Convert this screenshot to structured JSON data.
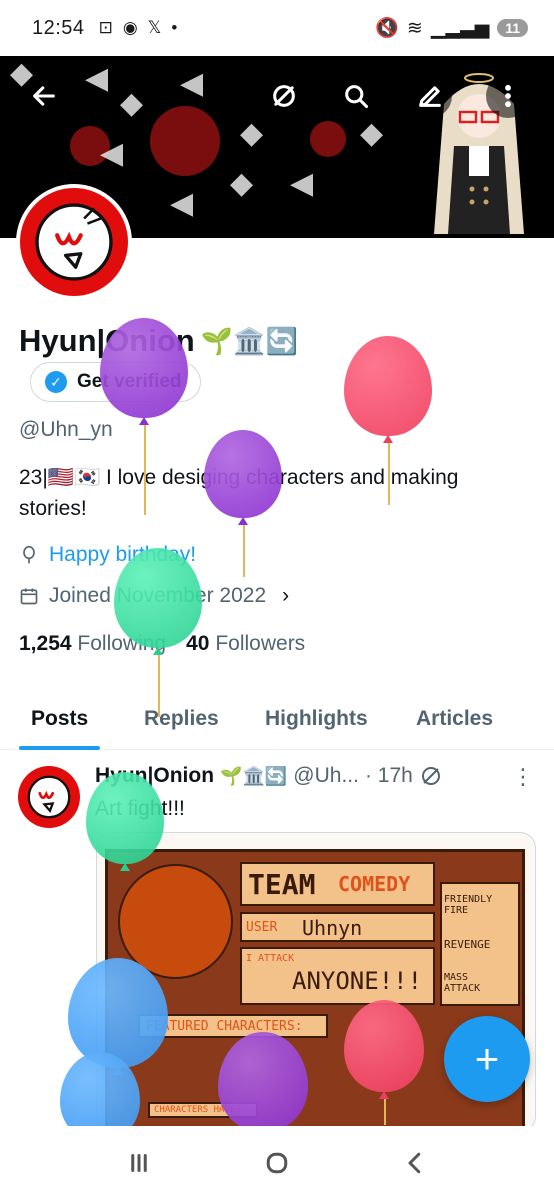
{
  "status_bar": {
    "time": "12:54",
    "battery": "11"
  },
  "profile": {
    "name": "Hyun|Onion",
    "name_emoji": "🌱🏛️🔄",
    "verify_label": "Get verified",
    "handle": "@Uhn_yn",
    "bio": "23|🇺🇸🇰🇷 I love desiging characters and making stories!",
    "birthday": "Happy birthday!",
    "joined": "Joined November 2022",
    "following_count": "1,254",
    "following_label": "Following",
    "followers_count": "40",
    "followers_label": "Followers"
  },
  "tabs": [
    "Posts",
    "Replies",
    "Highlights",
    "Articles"
  ],
  "active_tab": "Posts",
  "post": {
    "author": "Hyun|Onion",
    "emoji": "🌱🏛️🔄",
    "handle": "@Uh...",
    "time": "· 17h",
    "text": "Art fight!!!",
    "card": {
      "team": "TEAM",
      "team_name": "COMEDY",
      "user_label": "USER",
      "user_value": "Uhnyn",
      "attack_label": "I ATTACK",
      "attack_value": "ANYONE!!!",
      "option_1": "FRIENDLY FIRE",
      "option_2": "REVENGE",
      "option_3": "MASS ATTACK",
      "featured": "FEATURED CHARACTERS:",
      "characters_have": "CHARACTERS HAVE:"
    }
  },
  "colors": {
    "accent": "#1d9bf0",
    "text_primary": "#0f1419",
    "text_secondary": "#536471",
    "avatar_red": "#e10d0d"
  },
  "icons": {
    "back": "arrow-left-icon",
    "repost": "repost-off-icon",
    "search": "search-icon",
    "edit": "pencil-icon",
    "more": "more-vertical-icon",
    "birthday": "balloon-icon",
    "calendar": "calendar-icon",
    "fab": "plus-icon"
  }
}
